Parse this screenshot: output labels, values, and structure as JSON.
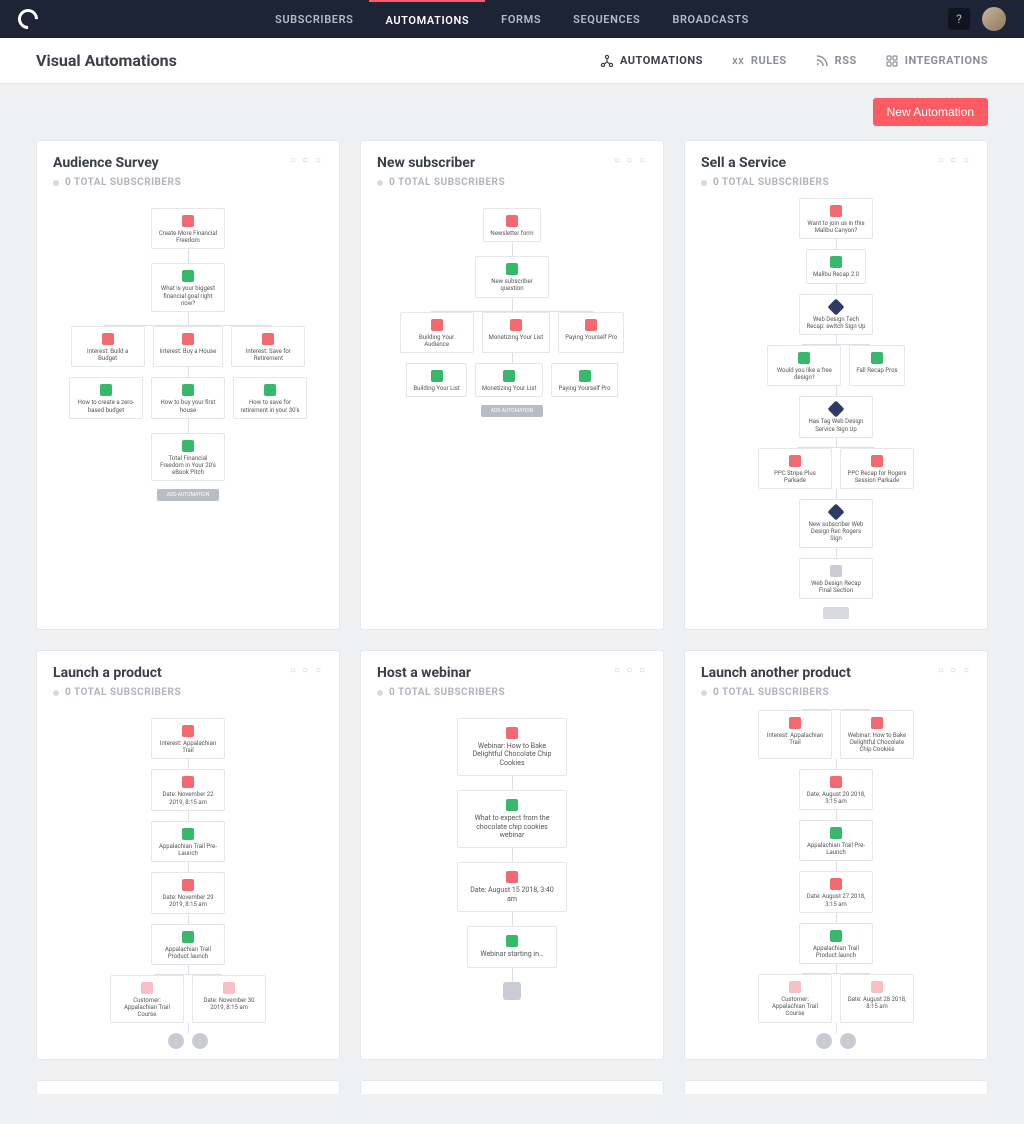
{
  "nav": {
    "items": [
      "SUBSCRIBERS",
      "AUTOMATIONS",
      "FORMS",
      "SEQUENCES",
      "BROADCASTS"
    ],
    "active": "AUTOMATIONS",
    "help": "?"
  },
  "subheader": {
    "title": "Visual Automations",
    "items": [
      {
        "label": "AUTOMATIONS",
        "icon": "automations-icon",
        "active": true
      },
      {
        "label": "RULES",
        "icon": "rules-icon",
        "active": false
      },
      {
        "label": "RSS",
        "icon": "rss-icon",
        "active": false
      },
      {
        "label": "INTEGRATIONS",
        "icon": "integrations-icon",
        "active": false
      }
    ]
  },
  "actions": {
    "new_automation": "New Automation"
  },
  "subscribers_label": "0 TOTAL SUBSCRIBERS",
  "cards": [
    {
      "title": "Audience Survey",
      "flow": {
        "start": {
          "icon": "red",
          "label": "Create More Financial Freedom"
        },
        "q": {
          "icon": "green",
          "label": "What is your biggest financial goal right now?"
        },
        "row1": [
          {
            "icon": "red",
            "label": "Interest: Build a Budget"
          },
          {
            "icon": "red",
            "label": "Interest: Buy a House"
          },
          {
            "icon": "red",
            "label": "Interest: Save for Retirement"
          }
        ],
        "row2": [
          {
            "icon": "green",
            "label": "How to create a zero-based budget"
          },
          {
            "icon": "green",
            "label": "How to buy your first house"
          },
          {
            "icon": "green",
            "label": "How to save for retirement in your 30's"
          }
        ],
        "end": {
          "icon": "green",
          "label": "Total Financial Freedom in Your 20's eBook Pitch"
        },
        "chip": "ADD AUTOMATION"
      }
    },
    {
      "title": "New subscriber",
      "flow": {
        "start": {
          "icon": "red",
          "label": "Newsletter form"
        },
        "q": {
          "icon": "green",
          "label": "New subscriber question"
        },
        "row1": [
          {
            "icon": "red",
            "label": "Building Your Audience"
          },
          {
            "icon": "red",
            "label": "Monetizing Your List"
          },
          {
            "icon": "red",
            "label": "Paying Yourself Pro"
          }
        ],
        "row2": [
          {
            "icon": "green",
            "label": "Building Your List"
          },
          {
            "icon": "green",
            "label": "Monetizing Your List"
          },
          {
            "icon": "green",
            "label": "Paying Yourself Pro"
          }
        ],
        "chip": "ADD AUTOMATION"
      }
    },
    {
      "title": "Sell a Service",
      "flow": {
        "start": {
          "icon": "red",
          "label": "Want to join us in this Malibu Canyon?"
        },
        "n1": {
          "icon": "green",
          "label": "Malibu Recap 2.0"
        },
        "d1": {
          "icon": "navy",
          "label": "Web Design Tech Recap: switch Sign Up"
        },
        "row1": [
          {
            "icon": "green",
            "label": "Would you like a free design?"
          },
          {
            "icon": "green",
            "label": "Fall Recap Pros"
          }
        ],
        "d2": {
          "icon": "navy",
          "label": "Has Tag Web Design Service Sign Up"
        },
        "row2": [
          {
            "icon": "red",
            "label": "PPC Stripe Plus Parkade"
          },
          {
            "icon": "red",
            "label": "PPC Recap for Rogers Session Parkade"
          }
        ],
        "d3": {
          "icon": "navy",
          "label": "New subscriber Web Design Rec Rogers Sign"
        },
        "g": {
          "icon": "gray",
          "label": "Web Design Recap Final Section"
        },
        "chip": ""
      }
    },
    {
      "title": "Launch a product",
      "flow": {
        "start": {
          "icon": "red",
          "label": "Interest: Appalachian Trail"
        },
        "n1": {
          "icon": "red",
          "label": "Date: November 22 2019, 8:15 am"
        },
        "n2": {
          "icon": "green",
          "label": "Appalachian Trail Pre-Launch"
        },
        "n3": {
          "icon": "red",
          "label": "Date: November 29 2019, 8:15 am"
        },
        "n4": {
          "icon": "green",
          "label": "Appalachian Trail Product launch"
        },
        "row": [
          {
            "icon": "red-lt",
            "label": "Customer: Appalachian Trail Course"
          },
          {
            "icon": "red-lt",
            "label": "Date: November 30 2019, 8:15 am"
          }
        ],
        "grow": [
          {
            "icon": "gray",
            "label": ""
          },
          {
            "icon": "gray",
            "label": ""
          }
        ]
      }
    },
    {
      "title": "Host a webinar",
      "flow": {
        "start": {
          "icon": "red",
          "label": "Webinar: How to Bake Delightful Chocolate Chip Cookies",
          "wide": true
        },
        "n1": {
          "icon": "green",
          "label": "What to expect from the chocolate chip cookies webinar",
          "wide": true
        },
        "n2": {
          "icon": "red",
          "label": "Date: August 15 2018, 3:40 am",
          "wide": true
        },
        "n3": {
          "icon": "green",
          "label": "Webinar starting in…",
          "wide": true
        },
        "gbox": {
          "icon": "gray",
          "label": ""
        }
      }
    },
    {
      "title": "Launch another product",
      "flow": {
        "startrow": [
          {
            "icon": "red",
            "label": "Interest: Appalachian Trail"
          },
          {
            "icon": "red",
            "label": "Webinar: How to Bake Delightful Chocolate Chip Cookies"
          }
        ],
        "n1": {
          "icon": "red",
          "label": "Date: August 20 2018, 3:15 am"
        },
        "n2": {
          "icon": "green",
          "label": "Appalachian Trail Pre-Launch"
        },
        "n3": {
          "icon": "red",
          "label": "Date: August 27 2018, 3:15 am"
        },
        "n4": {
          "icon": "green",
          "label": "Appalachian Trail Product launch"
        },
        "row": [
          {
            "icon": "red-lt",
            "label": "Customer: Appalachian Trail Course"
          },
          {
            "icon": "red-lt",
            "label": "Date: August 28 2018, 8:15 am"
          }
        ],
        "grow": [
          {
            "icon": "gray",
            "label": ""
          },
          {
            "icon": "gray",
            "label": ""
          }
        ]
      }
    }
  ]
}
